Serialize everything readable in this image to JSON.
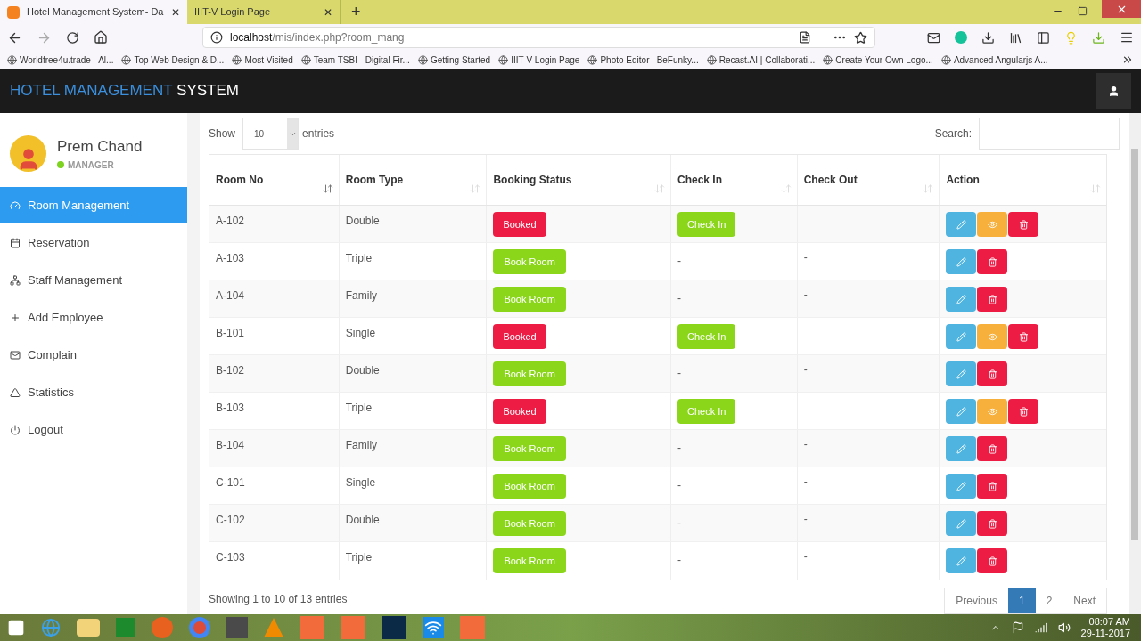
{
  "browser": {
    "tabs": [
      {
        "title": "Hotel Management System- Da",
        "selected": true,
        "close": "✕"
      },
      {
        "title": "IIIT-V Login Page",
        "selected": false,
        "close": "✕"
      }
    ],
    "new_tab": "+",
    "url_host": "localhost",
    "url_path": "/mis/index.php?room_mang",
    "bookmarks": [
      "Worldfree4u.trade - Al...",
      "Top Web Design & D...",
      "Most Visited",
      "Team TSBI - Digital Fir...",
      "Getting Started",
      "IIIT-V Login Page",
      "Photo Editor | BeFunky...",
      "Recast.AI | Collaborati...",
      "Create Your Own Logo...",
      "Advanced Angularjs A..."
    ]
  },
  "app": {
    "title_accent": "HOTEL MANAGEMENT",
    "title_rest": "SYSTEM"
  },
  "user": {
    "name": "Prem Chand",
    "role": "MANAGER",
    "online": true
  },
  "sidebar": {
    "items": [
      {
        "label": "Room Management",
        "selected": true
      },
      {
        "label": "Reservation",
        "selected": false
      },
      {
        "label": "Staff Management",
        "selected": false
      },
      {
        "label": "Add Employee",
        "selected": false
      },
      {
        "label": "Complain",
        "selected": false
      },
      {
        "label": "Statistics",
        "selected": false
      },
      {
        "label": "Logout",
        "selected": false
      }
    ]
  },
  "table": {
    "show_label": "Show",
    "page_size": "10",
    "entries_label": "entries",
    "search_label": "Search:",
    "columns": [
      {
        "label": "Room No",
        "sorted": true
      },
      {
        "label": "Room Type",
        "sorted": false
      },
      {
        "label": "Booking Status",
        "sorted": false
      },
      {
        "label": "Check In",
        "sorted": false
      },
      {
        "label": "Check Out",
        "sorted": false
      },
      {
        "label": "Action",
        "sorted": false
      }
    ],
    "rows": [
      {
        "room": "A-102",
        "type": "Double",
        "status": {
          "kind": "booked",
          "label": "Booked"
        },
        "check_in": {
          "kind": "button",
          "label": "Check In"
        },
        "actions": [
          {
            "kind": "edit"
          },
          {
            "kind": "view"
          },
          {
            "kind": "delete"
          }
        ]
      },
      {
        "room": "A-103",
        "type": "Triple",
        "status": {
          "kind": "available",
          "label": "Book Room"
        },
        "check_in": {
          "kind": "text",
          "label": "-"
        },
        "check_out": "-",
        "actions": [
          {
            "kind": "edit"
          },
          {
            "kind": "delete"
          }
        ]
      },
      {
        "room": "A-104",
        "type": "Family",
        "status": {
          "kind": "available",
          "label": "Book Room"
        },
        "check_in": {
          "kind": "text",
          "label": "-"
        },
        "check_out": "-",
        "actions": [
          {
            "kind": "edit"
          },
          {
            "kind": "delete"
          }
        ]
      },
      {
        "room": "B-101",
        "type": "Single",
        "status": {
          "kind": "booked",
          "label": "Booked"
        },
        "check_in": {
          "kind": "button",
          "label": "Check In"
        },
        "actions": [
          {
            "kind": "edit"
          },
          {
            "kind": "view"
          },
          {
            "kind": "delete"
          }
        ]
      },
      {
        "room": "B-102",
        "type": "Double",
        "status": {
          "kind": "available",
          "label": "Book Room"
        },
        "check_in": {
          "kind": "text",
          "label": "-"
        },
        "check_out": "-",
        "actions": [
          {
            "kind": "edit"
          },
          {
            "kind": "delete"
          }
        ]
      },
      {
        "room": "B-103",
        "type": "Triple",
        "status": {
          "kind": "booked",
          "label": "Booked"
        },
        "check_in": {
          "kind": "button",
          "label": "Check In"
        },
        "actions": [
          {
            "kind": "edit"
          },
          {
            "kind": "view"
          },
          {
            "kind": "delete"
          }
        ]
      },
      {
        "room": "B-104",
        "type": "Family",
        "status": {
          "kind": "available",
          "label": "Book Room"
        },
        "check_in": {
          "kind": "text",
          "label": "-"
        },
        "check_out": "-",
        "actions": [
          {
            "kind": "edit"
          },
          {
            "kind": "delete"
          }
        ]
      },
      {
        "room": "C-101",
        "type": "Single",
        "status": {
          "kind": "available",
          "label": "Book Room"
        },
        "check_in": {
          "kind": "text",
          "label": "-"
        },
        "check_out": "-",
        "actions": [
          {
            "kind": "edit"
          },
          {
            "kind": "delete"
          }
        ]
      },
      {
        "room": "C-102",
        "type": "Double",
        "status": {
          "kind": "available",
          "label": "Book Room"
        },
        "check_in": {
          "kind": "text",
          "label": "-"
        },
        "check_out": "-",
        "actions": [
          {
            "kind": "edit"
          },
          {
            "kind": "delete"
          }
        ]
      },
      {
        "room": "C-103",
        "type": "Triple",
        "status": {
          "kind": "available",
          "label": "Book Room"
        },
        "check_in": {
          "kind": "text",
          "label": "-"
        },
        "check_out": "-",
        "actions": [
          {
            "kind": "edit"
          },
          {
            "kind": "delete"
          }
        ]
      }
    ],
    "info": "Showing 1 to 10 of 13 entries",
    "pagination": [
      {
        "label": "Previous",
        "selected": false
      },
      {
        "label": "1",
        "selected": true
      },
      {
        "label": "2",
        "selected": false
      },
      {
        "label": "Next",
        "selected": false
      }
    ]
  },
  "taskbar": {
    "time": "08:07 AM",
    "date": "29-11-2017"
  }
}
